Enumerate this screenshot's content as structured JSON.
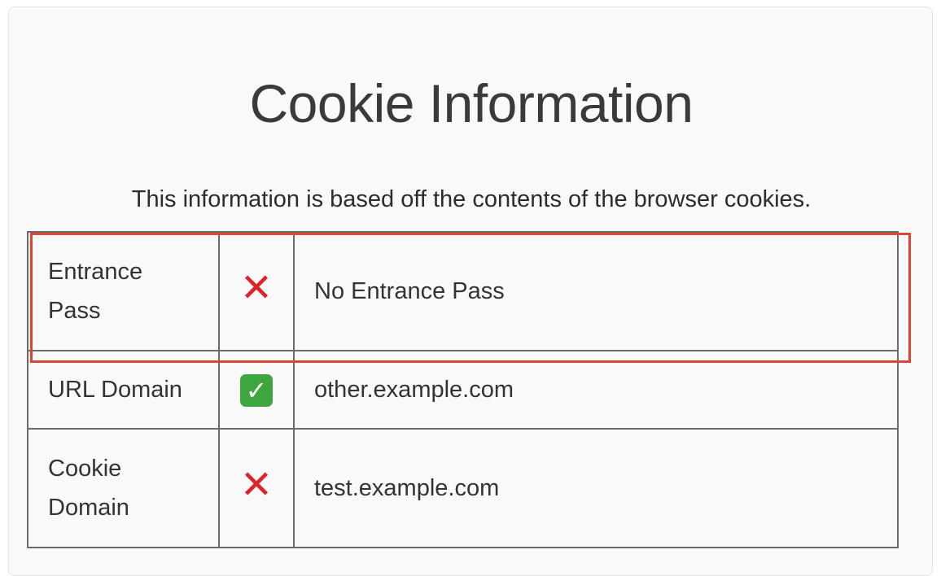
{
  "page": {
    "title": "Cookie Information",
    "subtitle": "This information is based off the contents of the browser cookies."
  },
  "rows": [
    {
      "label": "Entrance Pass",
      "status": "fail",
      "status_icon": "cross-icon",
      "status_glyph": "✕",
      "value": "No Entrance Pass",
      "highlighted": true
    },
    {
      "label": "URL Domain",
      "status": "pass",
      "status_icon": "check-icon",
      "status_glyph": "✓",
      "value": "other.example.com"
    },
    {
      "label": "Cookie Domain",
      "status": "fail",
      "status_icon": "cross-icon",
      "status_glyph": "✕",
      "value": "test.example.com"
    }
  ],
  "colors": {
    "highlight": "#dc4733",
    "fail": "#d8262a",
    "pass": "#3ea63f"
  }
}
